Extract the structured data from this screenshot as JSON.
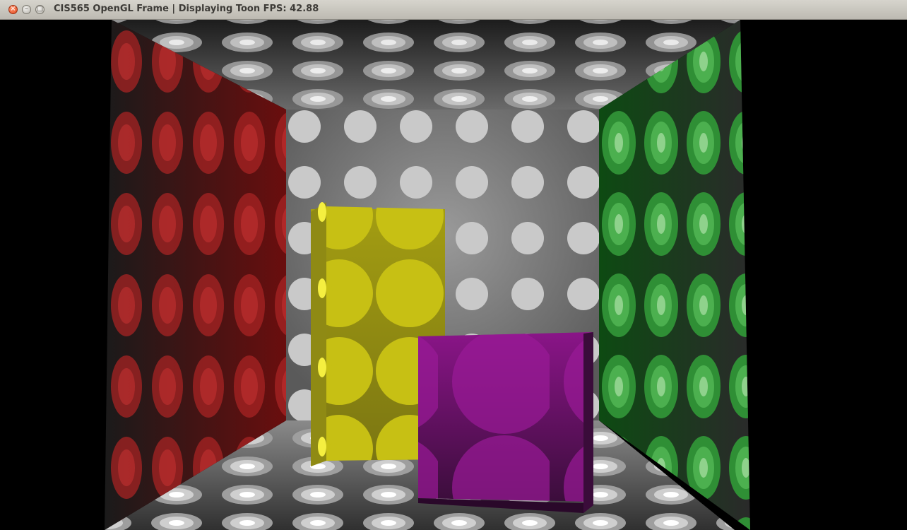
{
  "window": {
    "title": "CIS565 OpenGL Frame | Displaying Toon FPS: 42.88",
    "close_glyph": "×",
    "min_glyph": "–",
    "max_glyph": "□"
  },
  "scene": {
    "colors": {
      "background": "#000000",
      "back_wall": "#8a8a8a",
      "left_wall": "#8b1a1a",
      "right_wall": "#1f8a2a",
      "ceiling_floor": "#9a9a9a",
      "yellow_box": "#c8c21a",
      "purple_box": "#8a1a8a"
    }
  }
}
